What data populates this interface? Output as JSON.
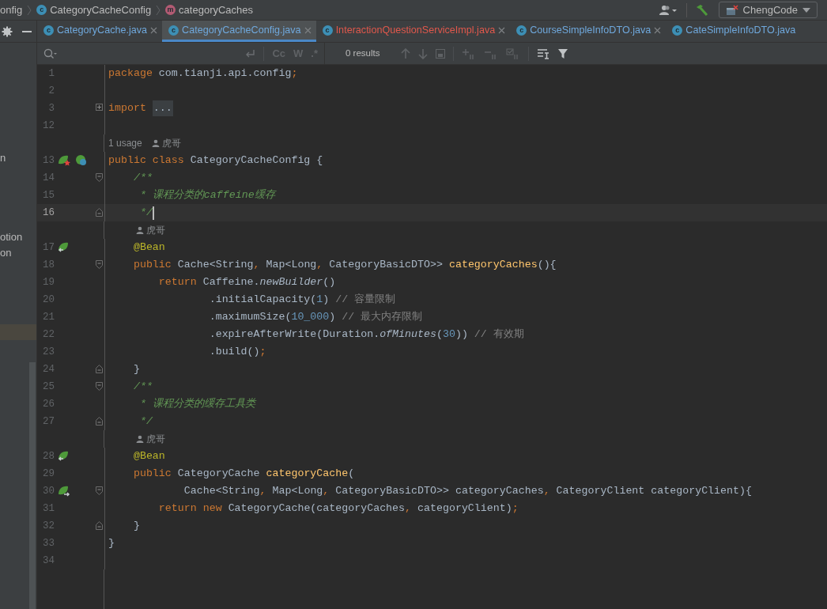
{
  "breadcrumbs": [
    {
      "text": "onfig"
    },
    {
      "text": "CategoryCacheConfig",
      "badge": "c",
      "kind": "class"
    },
    {
      "text": "categoryCaches",
      "badge": "m",
      "kind": "method"
    }
  ],
  "run_config": {
    "label": "ChengCode"
  },
  "tabs": [
    {
      "label": "CategoryCache.java",
      "badge": "c",
      "selected": false,
      "has_error": false,
      "closable": true
    },
    {
      "label": "CategoryCacheConfig.java",
      "badge": "c",
      "selected": true,
      "has_error": false,
      "closable": true
    },
    {
      "label": "InteractionQuestionServiceImpl.java",
      "badge": "c",
      "selected": false,
      "has_error": true,
      "closable": true
    },
    {
      "label": "CourseSimpleInfoDTO.java",
      "badge": "c",
      "selected": false,
      "has_error": false,
      "closable": true
    },
    {
      "label": "CateSimpleInfoDTO.java",
      "badge": "c",
      "selected": false,
      "has_error": false,
      "closable": false
    }
  ],
  "search": {
    "options": [
      "Cc",
      "W",
      ".*"
    ],
    "results": "0 results"
  },
  "left_panel": {
    "items": [
      {
        "text": "n",
        "selected": false
      },
      {
        "text": "otion",
        "selected": false
      },
      {
        "text": "on",
        "selected": false
      }
    ],
    "highlighted_row": true
  },
  "rows": [
    {
      "kind": "code",
      "number": "1",
      "current": false,
      "tokens": [
        {
          "kind": "kw",
          "text": "package "
        },
        {
          "kind": "plain",
          "text": "com.tianji.api.config"
        },
        {
          "kind": "kw",
          "text": ";"
        }
      ]
    },
    {
      "kind": "code",
      "number": "2",
      "current": false,
      "tokens": []
    },
    {
      "kind": "code",
      "number": "3",
      "current": false,
      "fold": {
        "kind": "collapsed"
      },
      "tokens": [
        {
          "kind": "kw",
          "text": "import "
        },
        {
          "kind": "folded",
          "text": "..."
        }
      ]
    },
    {
      "kind": "code",
      "number": "12",
      "current": false,
      "tokens": []
    },
    {
      "kind": "hint",
      "usages": "1 usage",
      "author": "虎哥"
    },
    {
      "kind": "code",
      "number": "13",
      "current": false,
      "gutter": [
        {
          "kind": "bean-star"
        },
        {
          "kind": "bean-linked"
        }
      ],
      "tokens": [
        {
          "kind": "kw",
          "text": "public class "
        },
        {
          "kind": "plain",
          "text": "CategoryCacheConfig {"
        }
      ]
    },
    {
      "kind": "code",
      "number": "14",
      "current": false,
      "fold": {
        "kind": "open"
      },
      "tokens": [
        {
          "kind": "doc",
          "text": "    /**"
        }
      ]
    },
    {
      "kind": "code",
      "number": "15",
      "current": false,
      "tokens": [
        {
          "kind": "doc",
          "text": "     * 课程分类的caffeine缓存"
        }
      ]
    },
    {
      "kind": "code",
      "number": "16",
      "current": true,
      "fold": {
        "kind": "close"
      },
      "tokens": [
        {
          "kind": "doc",
          "text": "     */"
        }
      ]
    },
    {
      "kind": "hint",
      "author": "    虎哥"
    },
    {
      "kind": "code",
      "number": "17",
      "current": false,
      "gutter": [
        {
          "kind": "bean-back"
        }
      ],
      "tokens": [
        {
          "kind": "ann",
          "text": "    @Bean"
        }
      ]
    },
    {
      "kind": "code",
      "number": "18",
      "current": false,
      "fold": {
        "kind": "open"
      },
      "tokens": [
        {
          "kind": "kw",
          "text": "    public "
        },
        {
          "kind": "plain",
          "text": "Cache<String"
        },
        {
          "kind": "kw",
          "text": ", "
        },
        {
          "kind": "plain",
          "text": "Map<Long"
        },
        {
          "kind": "kw",
          "text": ", "
        },
        {
          "kind": "plain",
          "text": "CategoryBasicDTO>> "
        },
        {
          "kind": "fn",
          "text": "categoryCaches"
        },
        {
          "kind": "plain",
          "text": "(){"
        }
      ]
    },
    {
      "kind": "code",
      "number": "19",
      "current": false,
      "tokens": [
        {
          "kind": "kw",
          "text": "        return "
        },
        {
          "kind": "plain",
          "text": "Caffeine."
        },
        {
          "kind": "static",
          "text": "newBuilder"
        },
        {
          "kind": "plain",
          "text": "()"
        }
      ]
    },
    {
      "kind": "code",
      "number": "20",
      "current": false,
      "tokens": [
        {
          "kind": "plain",
          "text": "                .initialCapacity("
        },
        {
          "kind": "num",
          "text": "1"
        },
        {
          "kind": "plain",
          "text": ") "
        },
        {
          "kind": "comment",
          "text": "// 容量限制"
        }
      ]
    },
    {
      "kind": "code",
      "number": "21",
      "current": false,
      "tokens": [
        {
          "kind": "plain",
          "text": "                .maximumSize("
        },
        {
          "kind": "num",
          "text": "10_000"
        },
        {
          "kind": "plain",
          "text": ") "
        },
        {
          "kind": "comment",
          "text": "// 最大内存限制"
        }
      ]
    },
    {
      "kind": "code",
      "number": "22",
      "current": false,
      "tokens": [
        {
          "kind": "plain",
          "text": "                .expireAfterWrite(Duration."
        },
        {
          "kind": "static",
          "text": "ofMinutes"
        },
        {
          "kind": "plain",
          "text": "("
        },
        {
          "kind": "num",
          "text": "30"
        },
        {
          "kind": "plain",
          "text": ")) "
        },
        {
          "kind": "comment",
          "text": "// 有效期"
        }
      ]
    },
    {
      "kind": "code",
      "number": "23",
      "current": false,
      "tokens": [
        {
          "kind": "plain",
          "text": "                .build()"
        },
        {
          "kind": "kw",
          "text": ";"
        }
      ]
    },
    {
      "kind": "code",
      "number": "24",
      "current": false,
      "fold": {
        "kind": "close"
      },
      "tokens": [
        {
          "kind": "plain",
          "text": "    }"
        }
      ]
    },
    {
      "kind": "code",
      "number": "25",
      "current": false,
      "fold": {
        "kind": "open"
      },
      "tokens": [
        {
          "kind": "doc",
          "text": "    /**"
        }
      ]
    },
    {
      "kind": "code",
      "number": "26",
      "current": false,
      "tokens": [
        {
          "kind": "doc",
          "text": "     * 课程分类的缓存工具类"
        }
      ]
    },
    {
      "kind": "code",
      "number": "27",
      "current": false,
      "fold": {
        "kind": "close"
      },
      "tokens": [
        {
          "kind": "doc",
          "text": "     */"
        }
      ]
    },
    {
      "kind": "hint",
      "author": "    虎哥"
    },
    {
      "kind": "code",
      "number": "28",
      "current": false,
      "gutter": [
        {
          "kind": "bean-back"
        }
      ],
      "tokens": [
        {
          "kind": "ann",
          "text": "    @Bean"
        }
      ]
    },
    {
      "kind": "code",
      "number": "29",
      "current": false,
      "tokens": [
        {
          "kind": "kw",
          "text": "    public "
        },
        {
          "kind": "plain",
          "text": "CategoryCache "
        },
        {
          "kind": "fn",
          "text": "categoryCache"
        },
        {
          "kind": "plain",
          "text": "("
        }
      ]
    },
    {
      "kind": "code",
      "number": "30",
      "current": false,
      "gutter": [
        {
          "kind": "bean-forward"
        }
      ],
      "fold": {
        "kind": "open"
      },
      "tokens": [
        {
          "kind": "plain",
          "text": "            Cache<String"
        },
        {
          "kind": "kw",
          "text": ", "
        },
        {
          "kind": "plain",
          "text": "Map<Long"
        },
        {
          "kind": "kw",
          "text": ", "
        },
        {
          "kind": "plain",
          "text": "CategoryBasicDTO>> categoryCaches"
        },
        {
          "kind": "kw",
          "text": ", "
        },
        {
          "kind": "plain",
          "text": "CategoryClient categoryClient){"
        }
      ]
    },
    {
      "kind": "code",
      "number": "31",
      "current": false,
      "tokens": [
        {
          "kind": "kw",
          "text": "        return new "
        },
        {
          "kind": "plain",
          "text": "CategoryCache(categoryCaches"
        },
        {
          "kind": "kw",
          "text": ", "
        },
        {
          "kind": "plain",
          "text": "categoryClient)"
        },
        {
          "kind": "kw",
          "text": ";"
        }
      ]
    },
    {
      "kind": "code",
      "number": "32",
      "current": false,
      "fold": {
        "kind": "close"
      },
      "tokens": [
        {
          "kind": "plain",
          "text": "    }"
        }
      ]
    },
    {
      "kind": "code",
      "number": "33",
      "current": false,
      "tokens": [
        {
          "kind": "plain",
          "text": "}"
        }
      ]
    },
    {
      "kind": "code",
      "number": "34",
      "current": false,
      "tokens": []
    }
  ]
}
